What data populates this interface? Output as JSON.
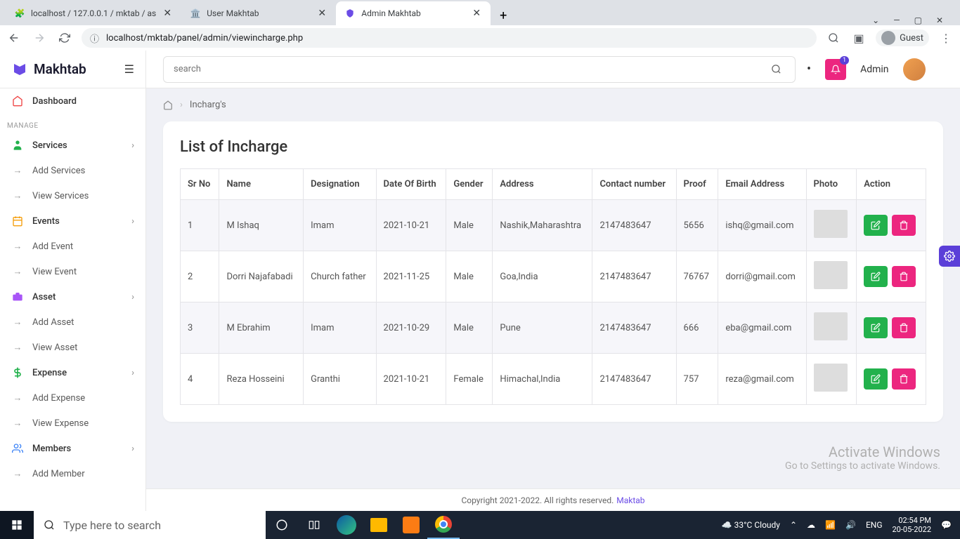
{
  "browser": {
    "tabs": [
      {
        "title": "localhost / 127.0.0.1 / mktab / as",
        "active": false
      },
      {
        "title": "User Makhtab",
        "active": false
      },
      {
        "title": "Admin Makhtab",
        "active": true
      }
    ],
    "url": "localhost/mktab/panel/admin/viewincharge.php",
    "profile": "Guest"
  },
  "header": {
    "brand": "Makhtab",
    "search_placeholder": "search",
    "notification_count": "1",
    "user_label": "Admin"
  },
  "sidebar": {
    "dashboard": "Dashboard",
    "manage_label": "MANAGE",
    "groups": [
      {
        "label": "Services",
        "icon_color": "#22b14c",
        "items": [
          "Add Services",
          "View Services"
        ]
      },
      {
        "label": "Events",
        "icon_color": "#f59e0b",
        "items": [
          "Add Event",
          "View Event"
        ]
      },
      {
        "label": "Asset",
        "icon_color": "#a855f7",
        "items": [
          "Add Asset",
          "View Asset"
        ]
      },
      {
        "label": "Expense",
        "icon_color": "#22b14c",
        "items": [
          "Add Expense",
          "View Expense"
        ]
      },
      {
        "label": "Members",
        "icon_color": "#3b82f6",
        "items": [
          "Add Member"
        ]
      }
    ]
  },
  "breadcrumb": {
    "current": "Incharg's"
  },
  "page": {
    "title": "List of Incharge",
    "headers": [
      "Sr No",
      "Name",
      "Designation",
      "Date Of Birth",
      "Gender",
      "Address",
      "Contact number",
      "Proof",
      "Email Address",
      "Photo",
      "Action"
    ],
    "rows": [
      {
        "sr": "1",
        "name": "M Ishaq",
        "desig": "Imam",
        "dob": "2021-10-21",
        "gender": "Male",
        "address": "Nashik,Maharashtra",
        "contact": "2147483647",
        "proof": "5656",
        "email": "ishq@gmail.com"
      },
      {
        "sr": "2",
        "name": "Dorri Najafabadi",
        "desig": "Church father",
        "dob": "2021-11-25",
        "gender": "Male",
        "address": "Goa,India",
        "contact": "2147483647",
        "proof": "76767",
        "email": "dorri@gmail.com"
      },
      {
        "sr": "3",
        "name": "M Ebrahim",
        "desig": "Imam",
        "dob": "2021-10-29",
        "gender": "Male",
        "address": "Pune",
        "contact": "2147483647",
        "proof": "666",
        "email": "eba@gmail.com"
      },
      {
        "sr": "4",
        "name": "Reza Hosseini",
        "desig": "Granthi",
        "dob": "2021-10-21",
        "gender": "Female",
        "address": "Himachal,India",
        "contact": "2147483647",
        "proof": "757",
        "email": "reza@gmail.com"
      }
    ]
  },
  "footer": {
    "copyright": "Copyright 2021-2022. All rights reserved.",
    "link": "Maktab"
  },
  "activate": {
    "line1": "Activate Windows",
    "line2": "Go to Settings to activate Windows."
  },
  "taskbar": {
    "search_placeholder": "Type here to search",
    "weather": "33°C Cloudy",
    "lang": "ENG",
    "time": "02:54 PM",
    "date": "20-05-2022"
  }
}
